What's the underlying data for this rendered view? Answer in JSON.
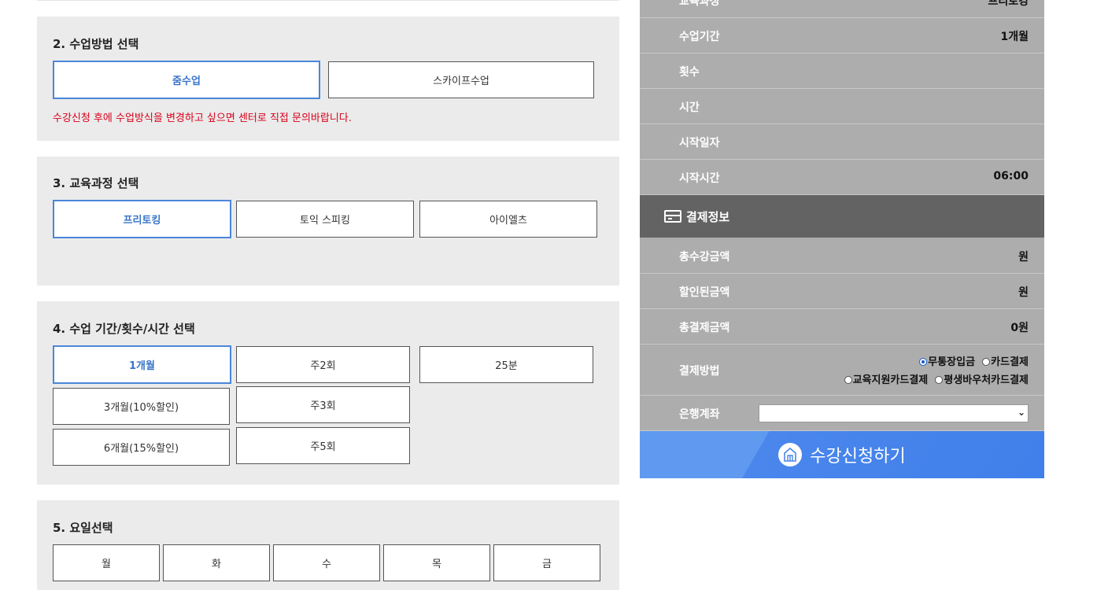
{
  "sections": {
    "method": {
      "title": "2. 수업방법 선택",
      "options": [
        "줌수업",
        "스카이프수업"
      ],
      "notice": "수강신청 후에 수업방식을 변경하고 싶으면 센터로 직접 문의바랍니다."
    },
    "course": {
      "title": "3. 교육과정 선택",
      "options": [
        "프리토킹",
        "토익 스피킹",
        "아이엘츠"
      ]
    },
    "period": {
      "title": "4. 수업 기간/횟수/시간 선택",
      "months": [
        "1개월",
        "3개월(10%할인)",
        "6개월(15%할인)"
      ],
      "times": [
        "주2회",
        "주3회",
        "주5회"
      ],
      "minutes": [
        "25분"
      ]
    },
    "days": {
      "title": "5. 요일선택",
      "options": [
        "월",
        "화",
        "수",
        "목",
        "금"
      ]
    }
  },
  "summary": {
    "course_label": "교육과정",
    "course_value": "프리토킹",
    "period_label": "수업기간",
    "period_value": "1개월",
    "count_label": "횟수",
    "time_label": "시간",
    "start_date_label": "시작일자",
    "start_time_label": "시작시간",
    "start_time_value": "06:00"
  },
  "payment": {
    "header": "결제정보",
    "total_label": "총수강금액",
    "total_value": "원",
    "discount_label": "할인된금액",
    "discount_value": "원",
    "final_label": "총결제금액",
    "final_value": "0원",
    "method_label": "결제방법",
    "methods": [
      "무통장입금",
      "카드결제",
      "교육지원카드결제",
      "평생바우처카드결제"
    ],
    "bank_label": "은행계좌",
    "bank_value": ""
  },
  "submit_label": "수강신청하기",
  "colors": {
    "accent": "#4a86d9",
    "notice": "#d8001a",
    "panel_row": "#adadad",
    "panel_header": "#636363",
    "submit": "#4a86ec"
  }
}
